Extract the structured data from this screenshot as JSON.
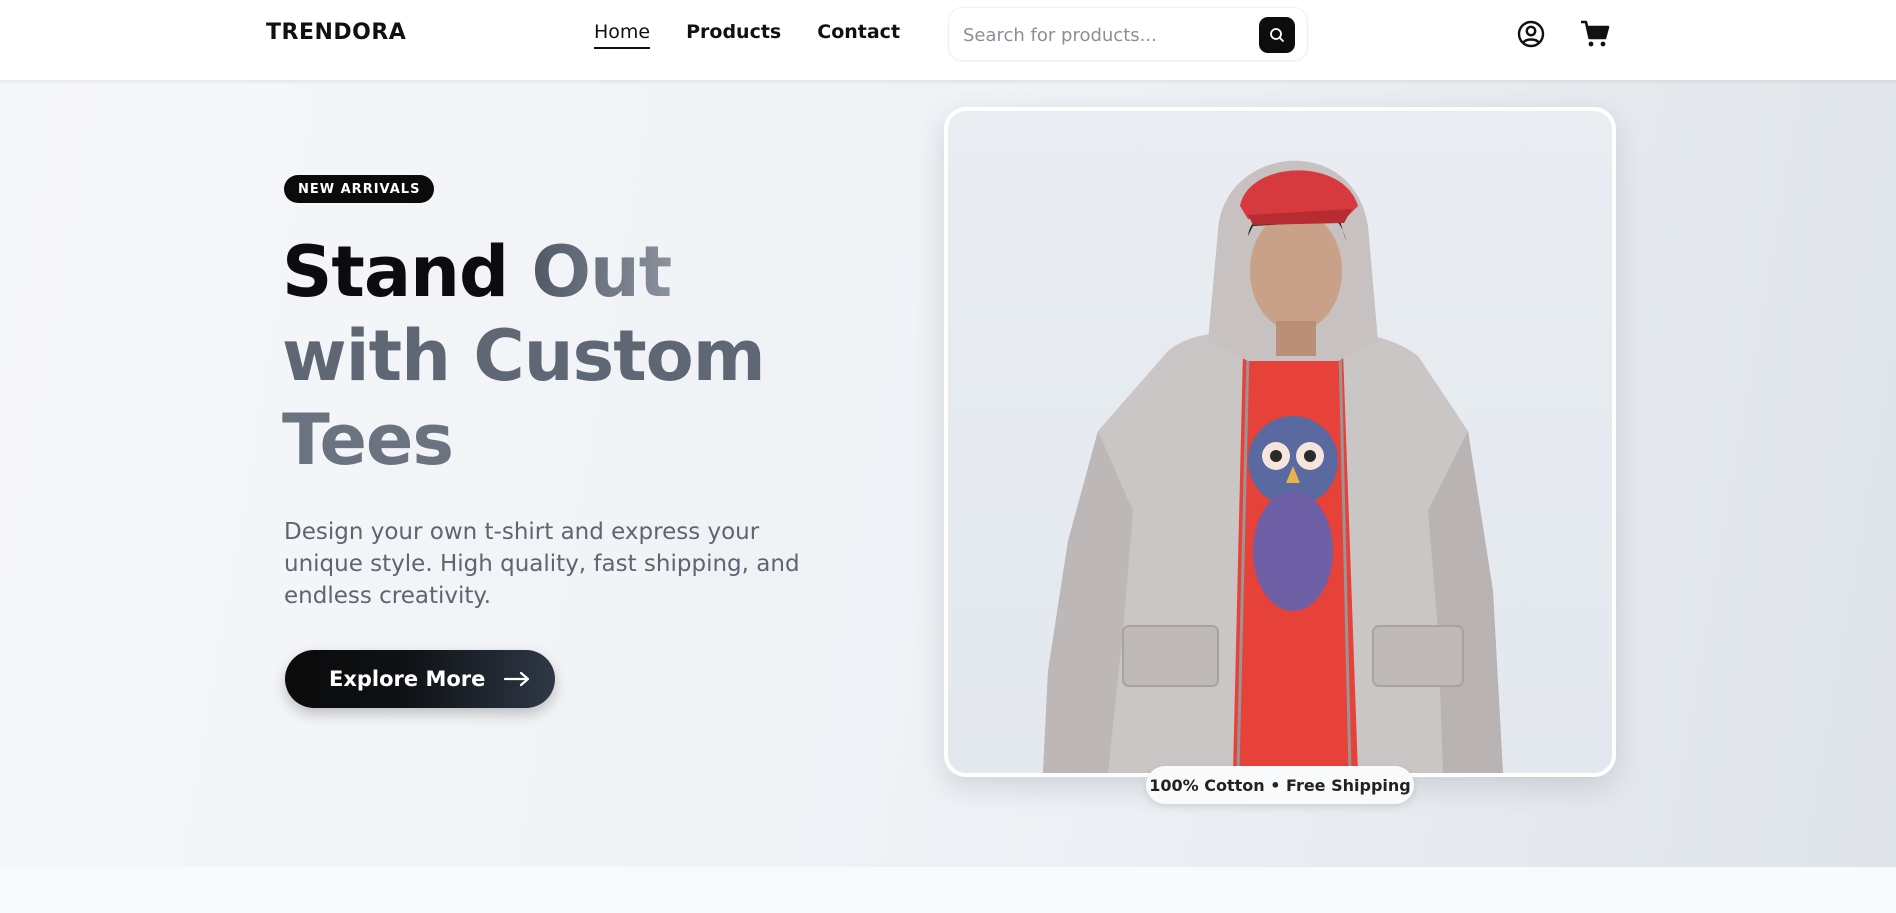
{
  "header": {
    "logo": "TRENDORA",
    "nav": [
      {
        "label": "Home",
        "active": true
      },
      {
        "label": "Products",
        "active": false
      },
      {
        "label": "Contact",
        "active": false
      }
    ],
    "search": {
      "placeholder": "Search for products...",
      "value": "",
      "button_icon": "search-icon"
    },
    "icons": [
      "user-icon",
      "cart-icon"
    ]
  },
  "hero": {
    "badge": "NEW ARRIVALS",
    "headline": {
      "part1": "Stand",
      "part2": "Out",
      "part3": "with Custom",
      "part4": "Tees"
    },
    "subtext": "Design your own t-shirt and express your unique style. High quality, fast shipping, and endless creativity.",
    "cta": {
      "label": "Explore More",
      "icon": "arrow-right-icon"
    },
    "image_caption": "100% Cotton • Free Shipping"
  },
  "colors": {
    "primary": "#0b0b0b",
    "accent_gray": "#6b7280",
    "background": "#eef1f5",
    "shirt_red": "#e6423a"
  }
}
